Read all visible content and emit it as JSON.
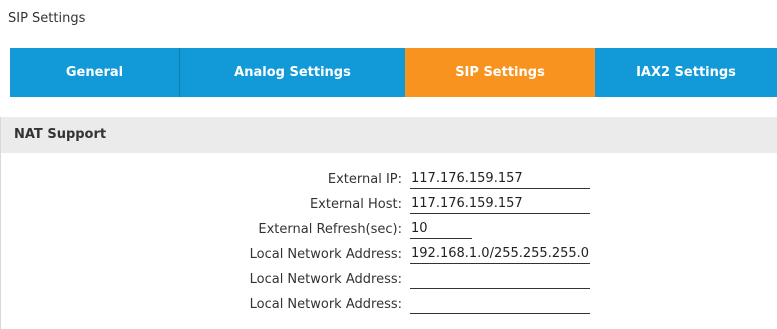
{
  "page": {
    "title": "SIP Settings"
  },
  "tabs": [
    {
      "label": "General",
      "active": false
    },
    {
      "label": "Analog Settings",
      "active": false
    },
    {
      "label": "SIP Settings",
      "active": true
    },
    {
      "label": "IAX2 Settings",
      "active": false
    }
  ],
  "section": {
    "title": "NAT Support",
    "fields": [
      {
        "label": "External IP:",
        "value": "117.176.159.157"
      },
      {
        "label": "External Host:",
        "value": "117.176.159.157"
      },
      {
        "label": "External Refresh(sec):",
        "value": "10"
      },
      {
        "label": "Local Network Address:",
        "value": "192.168.1.0/255.255.255.0"
      },
      {
        "label": "Local Network Address:",
        "value": ""
      },
      {
        "label": "Local Network Address:",
        "value": ""
      }
    ]
  },
  "colors": {
    "tab_blue": "#1199d8",
    "tab_active": "#f7931e",
    "section_header_bg": "#ebebeb"
  }
}
